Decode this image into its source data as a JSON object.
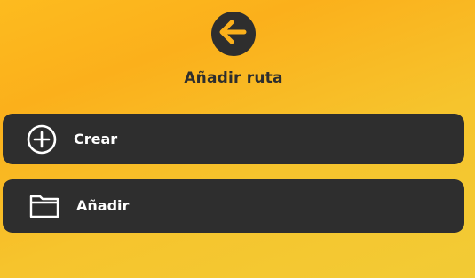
{
  "header": {
    "back_icon": "arrow-left-circle-icon",
    "title": "Añadir ruta"
  },
  "options": [
    {
      "label": "Crear",
      "icon": "plus-circle-icon"
    },
    {
      "label": "Añadir",
      "icon": "folder-icon"
    }
  ],
  "colors": {
    "background_top": "#fbb01b",
    "background_bottom": "#f2cb35",
    "panel": "#2e2e2e",
    "text_on_panel": "#ffffff",
    "accent": "#fbb01b"
  }
}
